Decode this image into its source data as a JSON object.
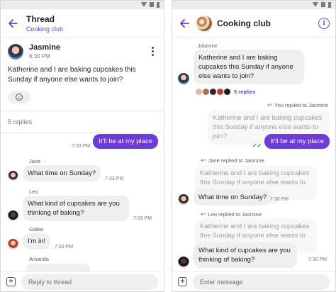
{
  "colors": {
    "accent": "#6c3bdb",
    "bubble_in": "#efefef",
    "read_tick": "#1d9b5a"
  },
  "left": {
    "header": {
      "title": "Thread",
      "subtitle": "Cooking club",
      "back_icon": "arrow-left-icon"
    },
    "parent": {
      "author": "Jasmine",
      "time": "6:30 PM",
      "text": "Katherine and I are baking cupcakes this Sunday if anyone else wants to join?",
      "menu_icon": "more-vert-icon",
      "reaction_icon": "add-reaction-icon"
    },
    "replies_count": "5 replies",
    "messages": [
      {
        "type": "outgoing",
        "text": "It'll be at my place",
        "time": "7:33 PM"
      },
      {
        "type": "incoming",
        "sender": "Jane",
        "text": "What time on Sunday?",
        "time": "7:33 PM"
      },
      {
        "type": "incoming",
        "sender": "Leo",
        "text": "What kind of cupcakes are you thinking of baking?",
        "time": "7:33 PM"
      },
      {
        "type": "incoming",
        "sender": "Gabie",
        "text": "I'm in!",
        "time": "7:33 PM"
      },
      {
        "type": "incoming",
        "sender": "Amanda"
      }
    ],
    "composer": {
      "placeholder": "Reply to thread",
      "add_icon": "add-box-icon"
    }
  },
  "right": {
    "header": {
      "title": "Cooking club",
      "back_icon": "arrow-left-icon",
      "info_icon": "info-icon"
    },
    "messages": [
      {
        "sender": "Jasmine",
        "text": "Katherine and I are baking cupcakes this Sunday if anyone else wants to join?"
      },
      {
        "replies_link": "5 replies"
      },
      {
        "reply_label": "You replied to Jasmine",
        "quoted": "Katherine and I are baking cupcakes this Sunday if anyone else wants to join?",
        "text": "It'll be at my place"
      },
      {
        "reply_label": "Jane replied to Jasmine",
        "quoted": "Katherine and I are baking cupcakes this Sunday if anyone else wants to join?",
        "text": "What time on Sunday?",
        "time": "7:30 PM"
      },
      {
        "reply_label": "Leo replied to Jasmine",
        "quoted": "Katherine and I are baking cupcakes this Sunday if anyone else wants to join?",
        "text": "What kind of cupcakes are you thinking of baking?",
        "time": "7:30 PM"
      }
    ],
    "composer": {
      "placeholder": "Enter message",
      "add_icon": "add-box-icon"
    }
  }
}
